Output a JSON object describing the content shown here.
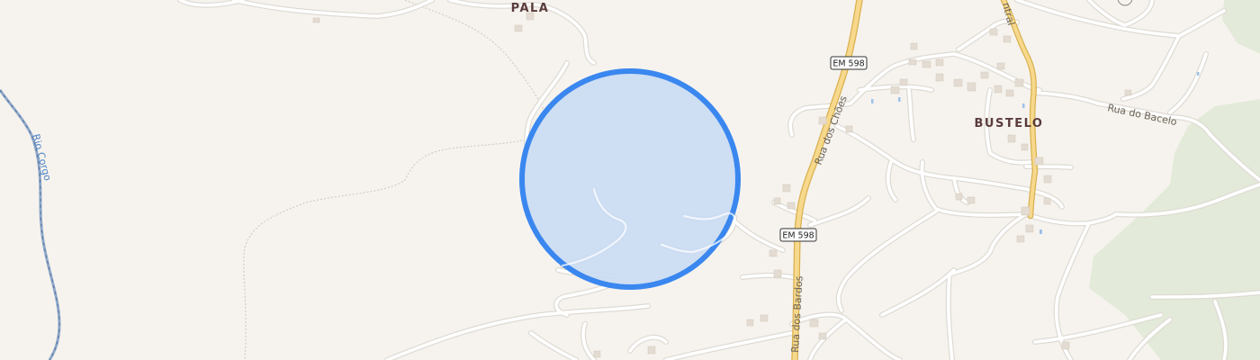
{
  "map": {
    "places": [
      {
        "name": "PALA"
      },
      {
        "name": "BUSTELO"
      }
    ],
    "streets": [
      {
        "name": "Rua dos Chões"
      },
      {
        "name": "Rua dos Bardos"
      },
      {
        "name": "Rua do Bacelo"
      },
      {
        "name": "ntral"
      }
    ],
    "river": {
      "name": "Rio Corgo"
    },
    "road_shields": [
      {
        "label": "EM 598"
      },
      {
        "label": "EM 598"
      }
    ],
    "marker": {
      "type": "accuracy-circle"
    },
    "colors": {
      "background": "#f6f3ee",
      "forest": "#e3ead9",
      "road_minor_fill": "#ffffff",
      "road_minor_casing": "#dedad3",
      "road_major_fill": "#f7d98d",
      "road_major_casing": "#d9b04f",
      "water": "#7fa6d9",
      "circle_fill": "#cadcf3",
      "circle_stroke": "#3a87ef",
      "building": "#e4dcd2"
    }
  }
}
